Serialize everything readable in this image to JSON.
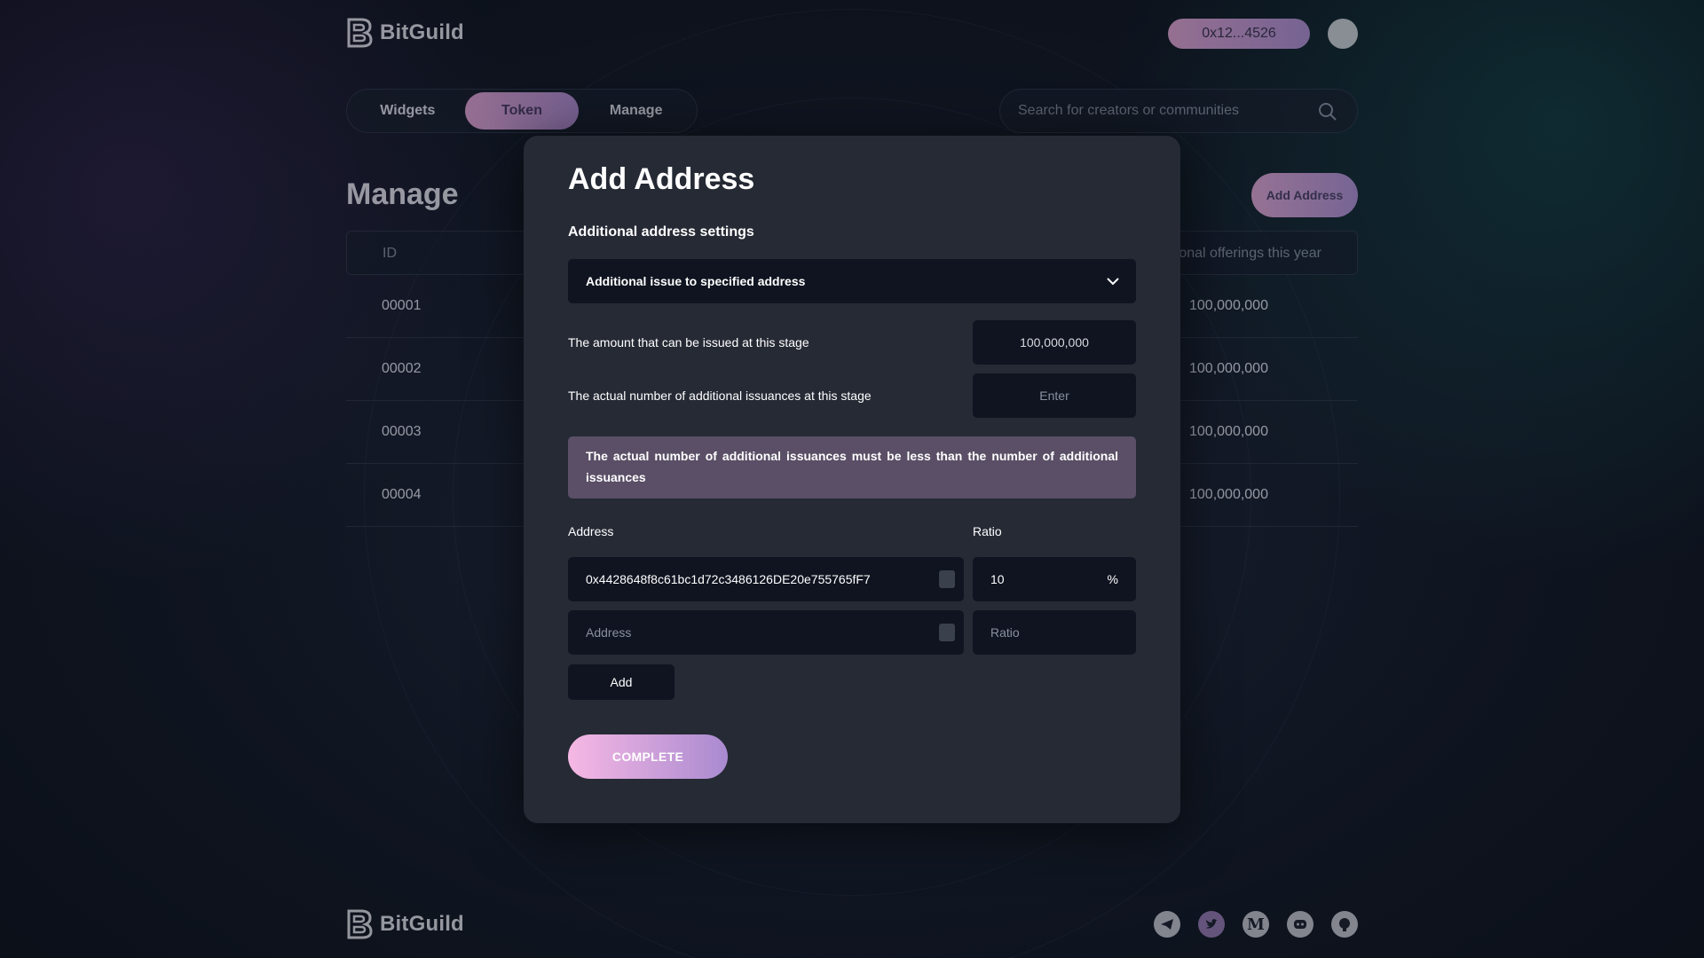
{
  "brand": {
    "name": "BitGuild"
  },
  "header": {
    "wallet": "0x12...4526"
  },
  "tabs": [
    {
      "label": "Widgets"
    },
    {
      "label": "Token",
      "active": true
    },
    {
      "label": "Manage"
    }
  ],
  "search": {
    "placeholder": "Search for creators or communities"
  },
  "page": {
    "title": "Manage",
    "add_button": "Add Address",
    "table": {
      "col_id": "ID",
      "col_right": "Additional offerings this year",
      "col_right_visible": "onal offerings this year",
      "rows": [
        {
          "id": "00001",
          "value": "100,000,000"
        },
        {
          "id": "00002",
          "value": "100,000,000"
        },
        {
          "id": "00003",
          "value": "100,000,000"
        },
        {
          "id": "00004",
          "value": "100,000,000"
        }
      ]
    }
  },
  "modal": {
    "title": "Add Address",
    "subtitle": "Additional address settings",
    "select_value": "Additional issue to specified address",
    "amount_label": "The amount that can be issued at this stage",
    "amount_value": "100,000,000",
    "actual_label": "The actual number of additional issuances at this stage",
    "actual_placeholder": "Enter",
    "warning": "The actual number of additional issuances must be less than the number of additional issuances",
    "address_label": "Address",
    "ratio_label": "Ratio",
    "addresses": [
      {
        "address": "0x4428648f8c61bc1d72c3486126DE20e755765fF7",
        "ratio": "10",
        "unit": "%"
      },
      {
        "address": "",
        "ratio": ""
      }
    ],
    "address_placeholder": "Address",
    "ratio_placeholder": "Ratio",
    "add_label": "Add",
    "complete_label": "COMPLETE"
  },
  "footer": {
    "socials": [
      "telegram-icon",
      "twitter-icon",
      "medium-icon",
      "discord-icon",
      "github-icon"
    ]
  },
  "colors": {
    "accent_start": "#e9a8d8",
    "accent_end": "#b68fd6",
    "warning_bg": "#5a4f66",
    "field_bg": "#0f1420"
  }
}
